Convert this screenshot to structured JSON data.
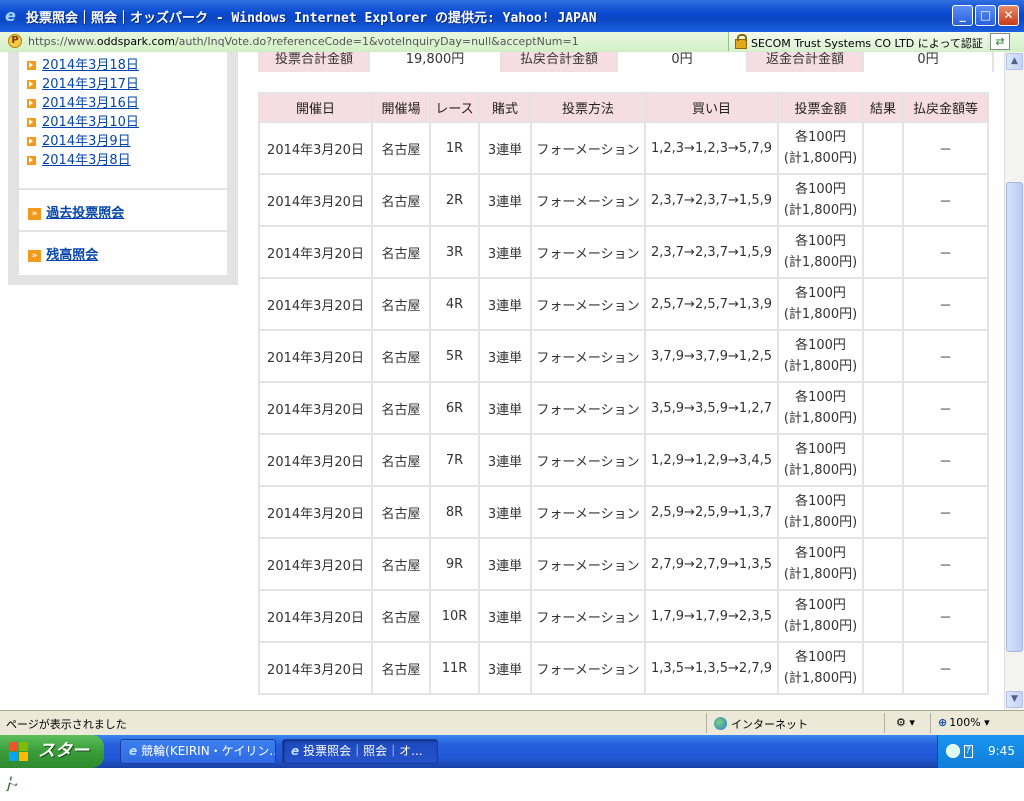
{
  "window": {
    "title": "投票照会｜照会｜オッズパーク - Windows Internet Explorer の提供元: Yahoo! JAPAN",
    "minimize": "_",
    "maximize": "□",
    "close": "✕"
  },
  "address": {
    "prefix": "https://www.",
    "host": "oddspark.com",
    "path": "/auth/InqVote.do?referenceCode=1&voteInquiryDay=null&acceptNum=1",
    "certificate": "SECOM Trust Systems CO LTD によって認証"
  },
  "sidebar": {
    "dates": [
      "2014年3月18日",
      "2014年3月17日",
      "2014年3月16日",
      "2014年3月10日",
      "2014年3月9日",
      "2014年3月8日"
    ],
    "past_inquiry": "過去投票照会",
    "balance_inquiry": "残高照会"
  },
  "summary": {
    "total_label": "投票合計金額",
    "total_value": "19,800円",
    "payout_label": "払戻合計金額",
    "payout_value": "0円",
    "refund_label": "返金合計金額",
    "refund_value": "0円"
  },
  "table": {
    "headers": [
      "開催日",
      "開催場",
      "レース",
      "賭式",
      "投票方法",
      "買い目",
      "投票金額",
      "結果",
      "払戻金額等"
    ],
    "rows": [
      {
        "date": "2014年3月20日",
        "venue": "名古屋",
        "race": "1R",
        "bet_type": "3連単",
        "method": "フォーメーション",
        "combo": "1,2,3→1,2,3→5,7,9",
        "amount": "各100円",
        "amount_total": "(計1,800円)",
        "result": "",
        "payout": "－"
      },
      {
        "date": "2014年3月20日",
        "venue": "名古屋",
        "race": "2R",
        "bet_type": "3連単",
        "method": "フォーメーション",
        "combo": "2,3,7→2,3,7→1,5,9",
        "amount": "各100円",
        "amount_total": "(計1,800円)",
        "result": "",
        "payout": "－"
      },
      {
        "date": "2014年3月20日",
        "venue": "名古屋",
        "race": "3R",
        "bet_type": "3連単",
        "method": "フォーメーション",
        "combo": "2,3,7→2,3,7→1,5,9",
        "amount": "各100円",
        "amount_total": "(計1,800円)",
        "result": "",
        "payout": "－"
      },
      {
        "date": "2014年3月20日",
        "venue": "名古屋",
        "race": "4R",
        "bet_type": "3連単",
        "method": "フォーメーション",
        "combo": "2,5,7→2,5,7→1,3,9",
        "amount": "各100円",
        "amount_total": "(計1,800円)",
        "result": "",
        "payout": "－"
      },
      {
        "date": "2014年3月20日",
        "venue": "名古屋",
        "race": "5R",
        "bet_type": "3連単",
        "method": "フォーメーション",
        "combo": "3,7,9→3,7,9→1,2,5",
        "amount": "各100円",
        "amount_total": "(計1,800円)",
        "result": "",
        "payout": "－"
      },
      {
        "date": "2014年3月20日",
        "venue": "名古屋",
        "race": "6R",
        "bet_type": "3連単",
        "method": "フォーメーション",
        "combo": "3,5,9→3,5,9→1,2,7",
        "amount": "各100円",
        "amount_total": "(計1,800円)",
        "result": "",
        "payout": "－"
      },
      {
        "date": "2014年3月20日",
        "venue": "名古屋",
        "race": "7R",
        "bet_type": "3連単",
        "method": "フォーメーション",
        "combo": "1,2,9→1,2,9→3,4,5",
        "amount": "各100円",
        "amount_total": "(計1,800円)",
        "result": "",
        "payout": "－"
      },
      {
        "date": "2014年3月20日",
        "venue": "名古屋",
        "race": "8R",
        "bet_type": "3連単",
        "method": "フォーメーション",
        "combo": "2,5,9→2,5,9→1,3,7",
        "amount": "各100円",
        "amount_total": "(計1,800円)",
        "result": "",
        "payout": "－"
      },
      {
        "date": "2014年3月20日",
        "venue": "名古屋",
        "race": "9R",
        "bet_type": "3連単",
        "method": "フォーメーション",
        "combo": "2,7,9→2,7,9→1,3,5",
        "amount": "各100円",
        "amount_total": "(計1,800円)",
        "result": "",
        "payout": "－"
      },
      {
        "date": "2014年3月20日",
        "venue": "名古屋",
        "race": "10R",
        "bet_type": "3連単",
        "method": "フォーメーション",
        "combo": "1,7,9→1,7,9→2,3,5",
        "amount": "各100円",
        "amount_total": "(計1,800円)",
        "result": "",
        "payout": "－"
      },
      {
        "date": "2014年3月20日",
        "venue": "名古屋",
        "race": "11R",
        "bet_type": "3連単",
        "method": "フォーメーション",
        "combo": "1,3,5→1,3,5→2,7,9",
        "amount": "各100円",
        "amount_total": "(計1,800円)",
        "result": "",
        "payout": "－"
      }
    ]
  },
  "statusbar": {
    "status": "ページが表示されました",
    "zone": "インターネット",
    "zoom": "100%"
  },
  "taskbar": {
    "start": "スタート",
    "tasks": [
      "競輪(KEIRIN・ケイリン...",
      "投票照会｜照会｜オ..."
    ],
    "clock": "9:45",
    "ime": "ｱ"
  }
}
